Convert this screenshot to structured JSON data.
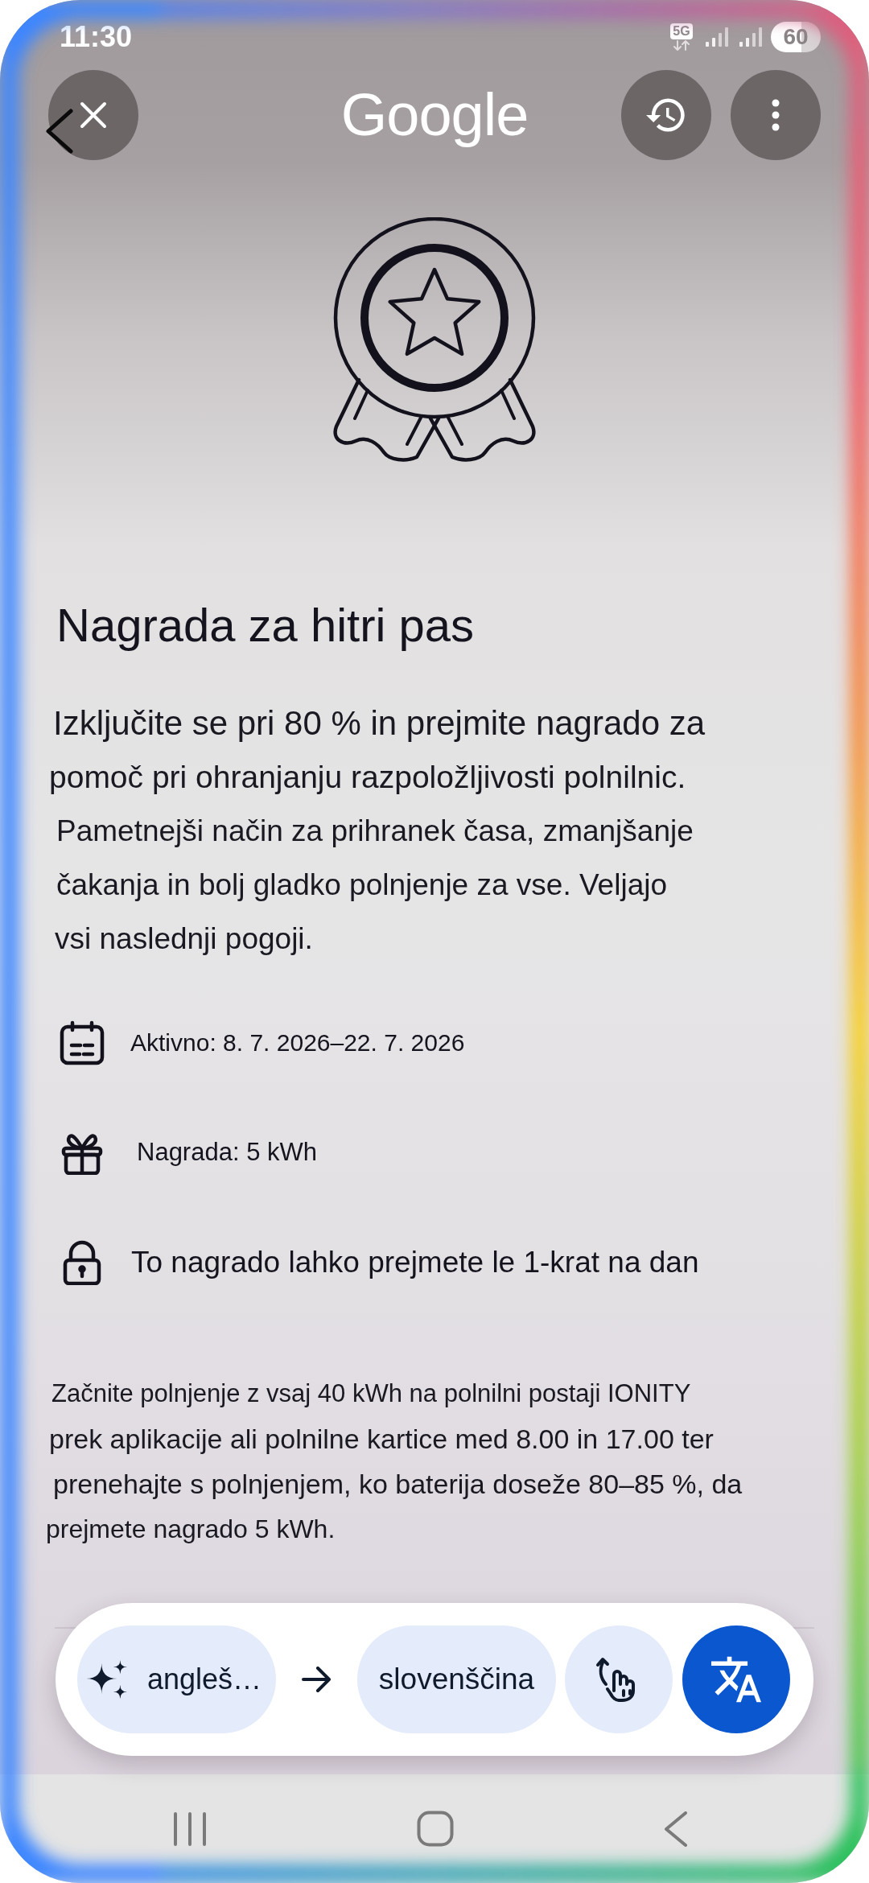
{
  "status_bar": {
    "time": "11:30",
    "network": "5G",
    "battery": "60"
  },
  "header": {
    "logo": "Google"
  },
  "offer": {
    "title": "Nagrada za hitri pas",
    "description_lines": [
      "Izključite se pri 80 % in prejmite nagrado za",
      "pomoč pri ohranjanju razpoložljivosti polnilnic.",
      "Pametnejši način za prihranek časa, zmanjšanje",
      "čakanja in bolj gladko polnjenje za vse. Veljajo",
      "vsi naslednji pogoji."
    ],
    "details": [
      {
        "kind": "period",
        "text": "Aktivno: 8. 7. 2026–22. 7. 2026"
      },
      {
        "kind": "reward",
        "text": "Nagrada: 5 kWh"
      },
      {
        "kind": "limit",
        "text": "To nagrado lahko prejmete le 1-krat na dan"
      }
    ],
    "terms_lines": [
      "Začnite polnjenje z vsaj 40 kWh na polnilni postaji IONITY",
      "prek aplikacije ali polnilne kartice med 8.00 in 17.00 ter",
      "prenehajte s polnjenjem, ko baterija doseže 80–85 %, da",
      "prejmete nagrado 5 kWh."
    ]
  },
  "translate_bar": {
    "source_language": "angleš…",
    "target_language": "slovenščina",
    "translating": true
  }
}
